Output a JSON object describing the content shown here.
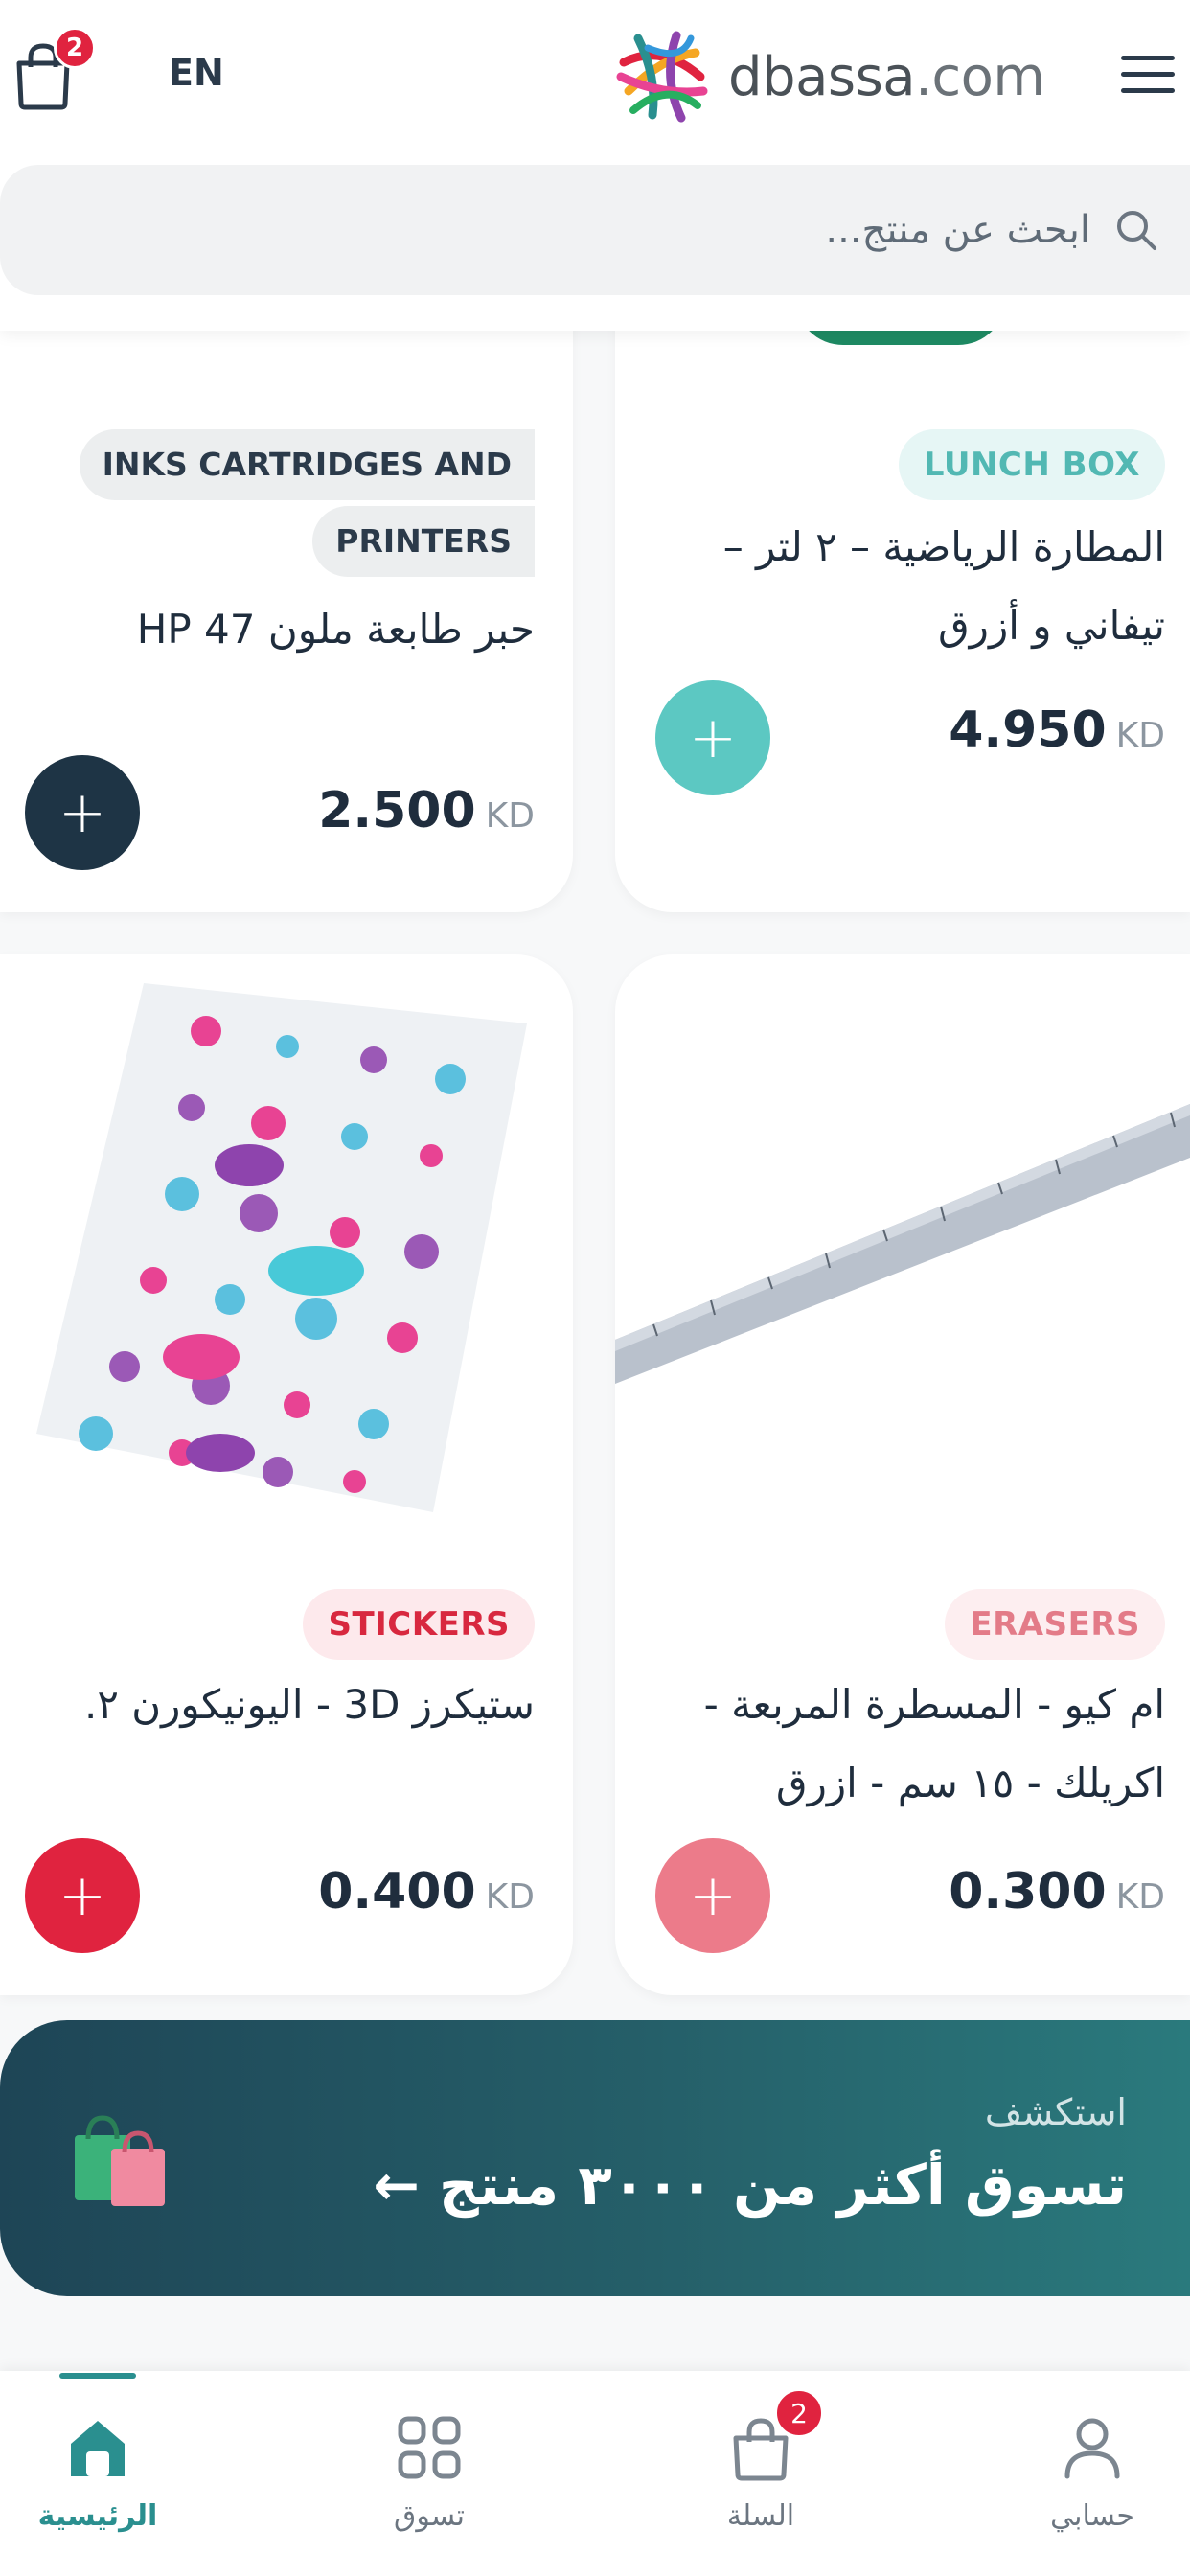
{
  "header": {
    "cart_count": "2",
    "lang_toggle": "EN",
    "logo_name": "dbassa",
    "logo_tld": ".com",
    "search_placeholder": "ابحث عن منتج..."
  },
  "products": [
    {
      "category": "LUNCH BOX",
      "title_lines": [
        "المطارة الرياضية – ٢ لتر –",
        "تيفاني و أزرق"
      ],
      "price": "4.950",
      "currency": "KD",
      "badge_color": "#e6f6f5",
      "badge_text_color": "#52b8b3",
      "add_color": "#5cc8c2"
    },
    {
      "category_lines": [
        "INKS CARTRIDGES AND",
        "PRINTERS"
      ],
      "title": "حبر طابعة ملون HP 47",
      "price": "2.500",
      "currency": "KD",
      "badge_color": "#eceeef",
      "badge_text_color": "#2b3a4a",
      "add_color": "#1e3445"
    },
    {
      "category": "ERASERS",
      "title_lines": [
        "ام كيو - المسطرة المربعة -",
        "اكريلك - ١٥ سم - ازرق"
      ],
      "price": "0.300",
      "currency": "KD",
      "badge_color": "#fdeef0",
      "badge_text_color": "#e37b88",
      "add_color": "#ec7b8a"
    },
    {
      "category": "STICKERS",
      "title": "ستيكرز 3D - اليونيكورن ٢.",
      "price": "0.400",
      "currency": "KD",
      "badge_color": "#fde9ec",
      "badge_text_color": "#d8283f",
      "add_color": "#e0233f"
    }
  ],
  "banner": {
    "kicker": "استكشف",
    "title": "تسوق أكثر من ٣٠٠٠ منتج ←"
  },
  "bottom_nav": {
    "home": "الرئيسية",
    "shop": "تسوق",
    "cart": "السلة",
    "cart_count": "2",
    "account": "حسابي"
  },
  "colors": {
    "accent": "#2a8f8f",
    "badge_red": "#e0233f",
    "dark": "#1f2d3d"
  }
}
